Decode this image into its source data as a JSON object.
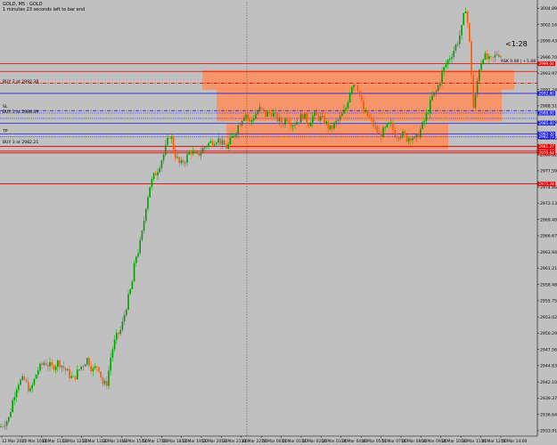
{
  "header": {
    "symbol_line": "GOLD, M5 : GOLD",
    "timer_line": "1 minutes 23 seconds left to bar end"
  },
  "colors": {
    "background": "#c0c0c0",
    "bull": "#00a000",
    "bear": "#ff5a00",
    "zone": "#ff8c5a",
    "blue_line": "#1f1fe6",
    "red_line": "#e60000",
    "grid_vertical": "#555555",
    "label_bg_blue": "#1f1fe6",
    "label_bg_red": "#e60000"
  },
  "chart_data": {
    "type": "candlestick",
    "ylim": [
      2933.0,
      3006.0
    ],
    "y_ticks": [
      "3004.89",
      "3002.16",
      "2999.43",
      "2996.70",
      "2993.97",
      "2991.24",
      "2988.51",
      "2985.78",
      "2983.05",
      "2980.32",
      "2977.59",
      "2974.86",
      "2972.13",
      "2969.40",
      "2966.67",
      "2963.94",
      "2961.21",
      "2958.48",
      "2955.75",
      "2953.02",
      "2950.29",
      "2947.56",
      "2944.83",
      "2942.10",
      "2939.37",
      "2936.64",
      "2933.91"
    ],
    "x_ticks": [
      "12 Mar 2025",
      "13 Mar 10:00",
      "13 Mar 11:10",
      "13 Mar 12:20",
      "13 Mar 13:30",
      "13 Mar 14:40",
      "13 Mar 15:50",
      "13 Mar 17:00",
      "13 Mar 18:10",
      "13 Mar 19:20",
      "13 Mar 20:30",
      "13 Mar 21:40",
      "13 Mar 22:50",
      "14 Mar 00:00",
      "14 Mar 01:10",
      "14 Mar 02:20",
      "14 Mar 03:30",
      "14 Mar 04:40",
      "14 Mar 05:50",
      "14 Mar 07:00",
      "14 Mar 08:10",
      "14 Mar 09:20",
      "14 Mar 10:30",
      "14 Mar 11:40",
      "14 Mar 12:50",
      "14 Mar 14:00"
    ],
    "path_points": [
      [
        0,
        2934.5
      ],
      [
        10,
        2936.0
      ],
      [
        15,
        2939.5
      ],
      [
        20,
        2942.0
      ],
      [
        27,
        2942.5
      ],
      [
        34,
        2940.5
      ],
      [
        42,
        2944.0
      ],
      [
        50,
        2945.5
      ],
      [
        58,
        2944.5
      ],
      [
        66,
        2945.5
      ],
      [
        74,
        2944.0
      ],
      [
        82,
        2942.5
      ],
      [
        90,
        2944.5
      ],
      [
        98,
        2946.0
      ],
      [
        104,
        2944.0
      ],
      [
        110,
        2945.0
      ],
      [
        116,
        2941.5
      ],
      [
        120,
        2942.0
      ],
      [
        125,
        2947.0
      ],
      [
        130,
        2949.5
      ],
      [
        136,
        2951.0
      ],
      [
        142,
        2955.0
      ],
      [
        148,
        2958.5
      ],
      [
        152,
        2963.0
      ],
      [
        156,
        2964.5
      ],
      [
        160,
        2967.5
      ],
      [
        164,
        2972.0
      ],
      [
        168,
        2975.0
      ],
      [
        172,
        2976.5
      ],
      [
        176,
        2977.5
      ],
      [
        180,
        2979.0
      ],
      [
        184,
        2980.5
      ],
      [
        188,
        2982.5
      ],
      [
        191,
        2984.0
      ],
      [
        196,
        2980.5
      ],
      [
        202,
        2978.5
      ],
      [
        208,
        2979.5
      ],
      [
        214,
        2981.0
      ],
      [
        220,
        2980.0
      ],
      [
        226,
        2981.0
      ],
      [
        232,
        2982.0
      ],
      [
        238,
        2982.5
      ],
      [
        244,
        2983.0
      ],
      [
        250,
        2982.0
      ],
      [
        255,
        2981.5
      ],
      [
        260,
        2983.0
      ],
      [
        265,
        2984.5
      ],
      [
        270,
        2986.0
      ],
      [
        275,
        2987.5
      ],
      [
        280,
        2985.5
      ],
      [
        286,
        2987.0
      ],
      [
        292,
        2988.0
      ],
      [
        298,
        2987.0
      ],
      [
        304,
        2987.5
      ],
      [
        310,
        2986.5
      ],
      [
        316,
        2985.5
      ],
      [
        322,
        2986.5
      ],
      [
        328,
        2985.5
      ],
      [
        334,
        2986.0
      ],
      [
        340,
        2987.0
      ],
      [
        346,
        2985.5
      ],
      [
        352,
        2987.0
      ],
      [
        358,
        2986.5
      ],
      [
        364,
        2986.0
      ],
      [
        370,
        2984.5
      ],
      [
        376,
        2985.5
      ],
      [
        382,
        2986.5
      ],
      [
        388,
        2988.0
      ],
      [
        394,
        2992.0
      ],
      [
        400,
        2992.5
      ],
      [
        404,
        2990.0
      ],
      [
        408,
        2987.5
      ],
      [
        414,
        2986.5
      ],
      [
        420,
        2985.0
      ],
      [
        426,
        2983.5
      ],
      [
        432,
        2984.5
      ],
      [
        438,
        2985.5
      ],
      [
        444,
        2983.5
      ],
      [
        450,
        2984.0
      ],
      [
        456,
        2983.0
      ],
      [
        462,
        2983.5
      ],
      [
        466,
        2982.5
      ],
      [
        470,
        2984.0
      ],
      [
        475,
        2985.5
      ],
      [
        480,
        2987.5
      ],
      [
        485,
        2990.0
      ],
      [
        490,
        2991.0
      ],
      [
        496,
        2994.0
      ],
      [
        502,
        2996.0
      ],
      [
        508,
        2997.5
      ],
      [
        514,
        2999.5
      ],
      [
        519,
        3002.0
      ],
      [
        522,
        3005.5
      ],
      [
        525,
        3002.0
      ],
      [
        528,
        2997.0
      ],
      [
        531,
        2988.0
      ],
      [
        534,
        2990.5
      ],
      [
        537,
        2994.5
      ],
      [
        542,
        2997.0
      ],
      [
        546,
        2996.5
      ],
      [
        550,
        2996.0
      ],
      [
        554,
        2996.5
      ],
      [
        558,
        2997.5
      ],
      [
        562,
        2997.0
      ]
    ],
    "zones": [
      {
        "x0": 227,
        "x1": 577,
        "y0": 2994.5,
        "y1": 2991.2
      },
      {
        "x0": 243,
        "x1": 563,
        "y0": 2991.6,
        "y1": 2985.9
      },
      {
        "x0": 254,
        "x1": 503,
        "y0": 2985.5,
        "y1": 2981.2
      }
    ],
    "horizontal_lines": [
      {
        "y": 2995.6,
        "color": "red_line",
        "style": "solid"
      },
      {
        "y": 2994.3,
        "color": "red_line",
        "style": "solid"
      },
      {
        "y": 2992.3,
        "color": "red_line",
        "style": "dashdot"
      },
      {
        "y": 2990.6,
        "color": "blue_line",
        "style": "solid"
      },
      {
        "y": 2987.7,
        "color": "blue_line",
        "style": "dashdot"
      },
      {
        "y": 2987.3,
        "color": "blue_line",
        "style": "dotted"
      },
      {
        "y": 2986.4,
        "color": "blue_line",
        "style": "dotted"
      },
      {
        "y": 2985.6,
        "color": "blue_line",
        "style": "solid"
      },
      {
        "y": 2983.8,
        "color": "blue_line",
        "style": "solid"
      },
      {
        "y": 2983.3,
        "color": "blue_line",
        "style": "dotted"
      },
      {
        "y": 2981.7,
        "color": "red_line",
        "style": "solid"
      },
      {
        "y": 2980.9,
        "color": "red_line",
        "style": "solid"
      },
      {
        "y": 2980.6,
        "color": "red_line",
        "style": "solid"
      },
      {
        "y": 2975.4,
        "color": "red_line",
        "style": "solid"
      }
    ],
    "price_badges": [
      {
        "y": 2995.6,
        "text": "2999.04",
        "color": "label_bg_red"
      },
      {
        "y": 2990.6,
        "text": "2992.80",
        "color": "label_bg_blue"
      },
      {
        "y": 2987.3,
        "text": "2988.00",
        "color": "label_bg_blue"
      },
      {
        "y": 2985.6,
        "text": "2985.40",
        "color": "label_bg_blue"
      },
      {
        "y": 2983.8,
        "text": "2983.20",
        "color": "label_bg_blue"
      },
      {
        "y": 2983.3,
        "text": "2982.75",
        "color": "label_bg_blue"
      },
      {
        "y": 2981.7,
        "text": "2981.27",
        "color": "label_bg_red"
      },
      {
        "y": 2980.9,
        "text": "2980.52",
        "color": "label_bg_red"
      },
      {
        "y": 2980.6,
        "text": "2979.84",
        "color": "label_bg_red"
      },
      {
        "y": 2975.4,
        "text": "2975.28",
        "color": "label_bg_red"
      }
    ],
    "annotations": [
      {
        "text": "BUY 2 at 2992.38",
        "y": 2992.3
      },
      {
        "text": "SL",
        "y": 2988.1
      },
      {
        "text": "BUY 1 at 2988.49",
        "y": 2987.2
      },
      {
        "text": "TP",
        "y": 2984.0
      },
      {
        "text": "BUY 3 at 2982.21",
        "y": 2982.1
      }
    ],
    "top_right_label": "ASK 0.00 | +1.48",
    "countdown": "<1:28",
    "vertical_line_x": 277
  }
}
